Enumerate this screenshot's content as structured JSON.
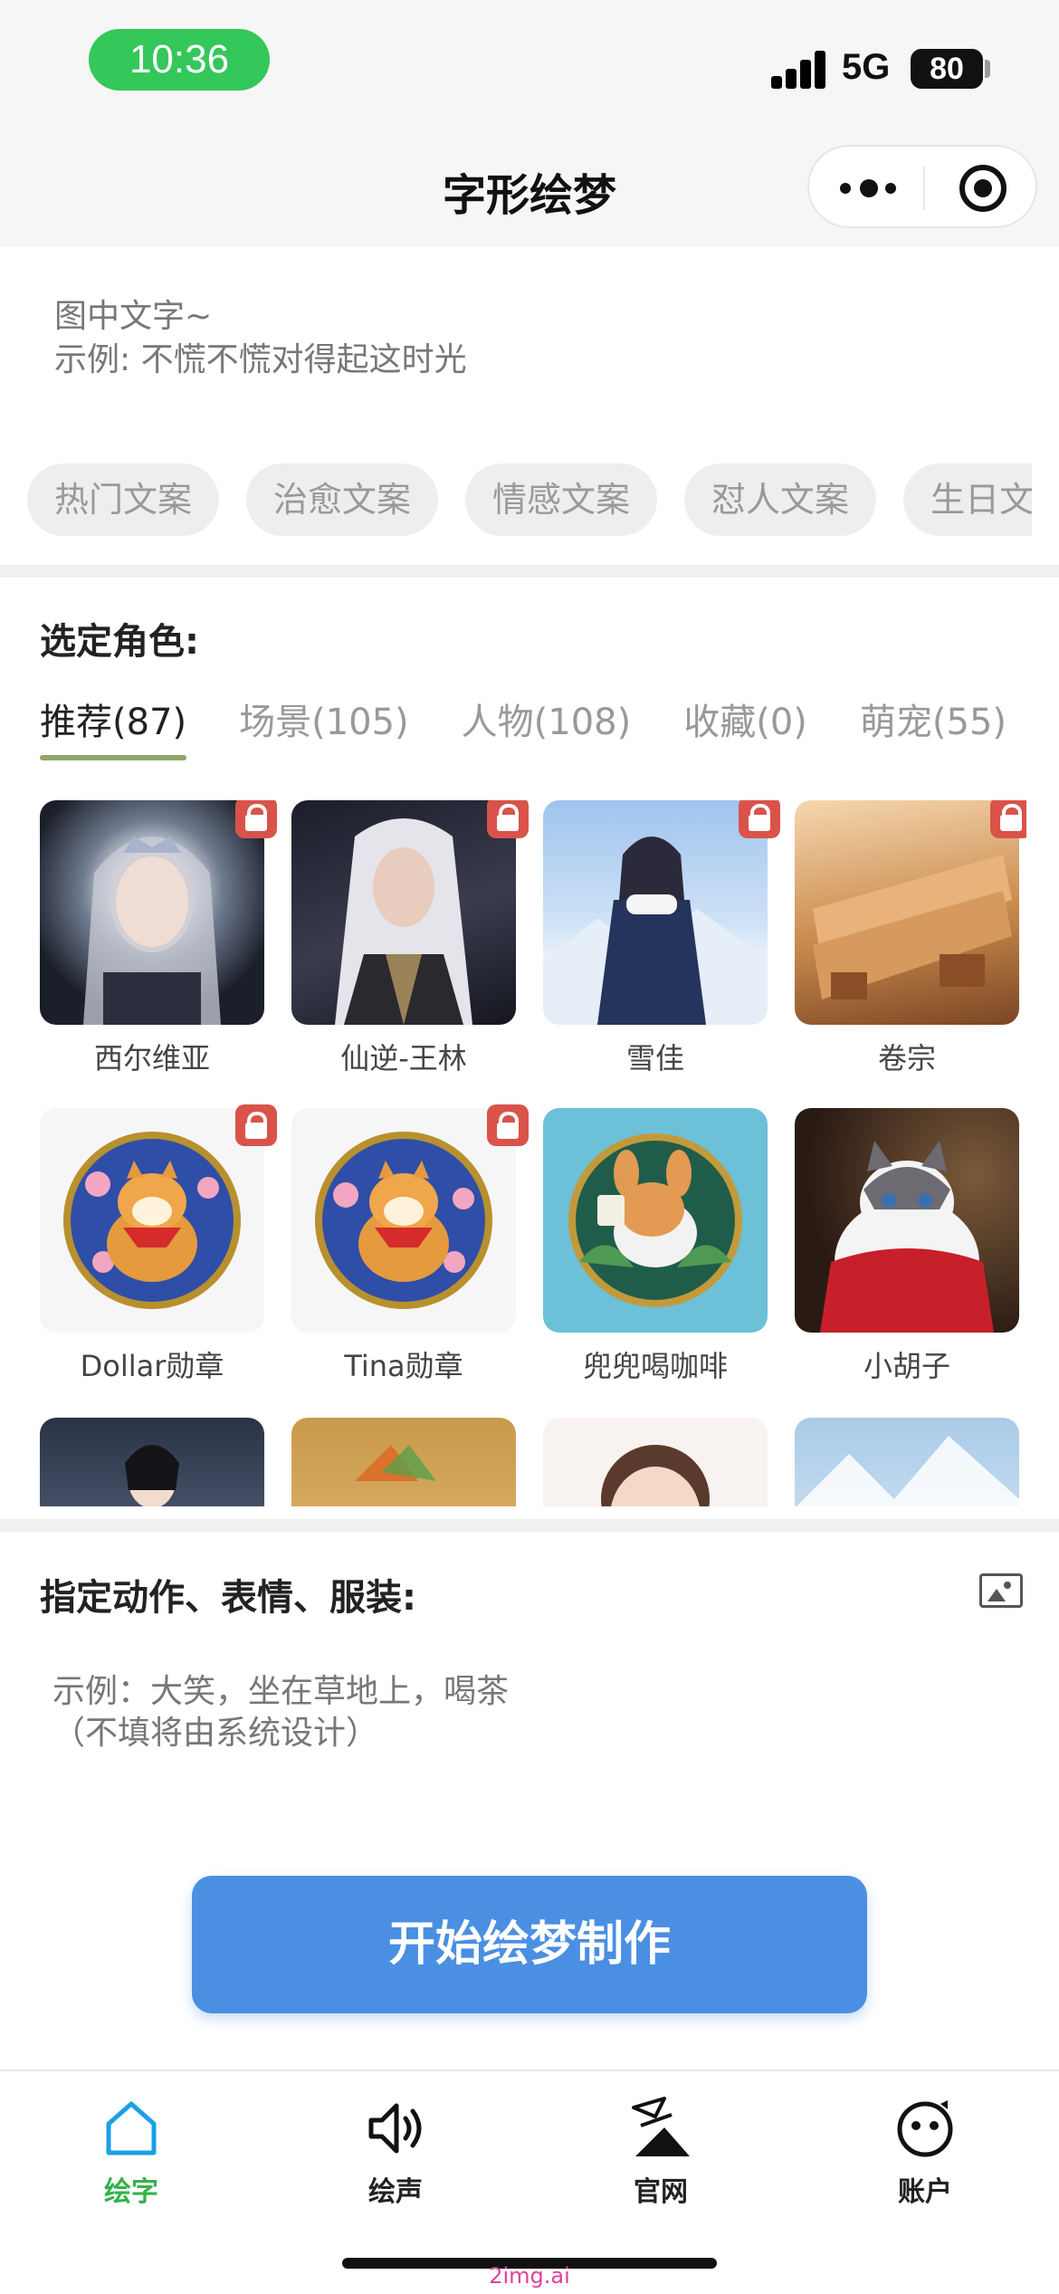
{
  "status_bar": {
    "time": "10:36",
    "network": "5G",
    "battery": "80"
  },
  "nav": {
    "title": "字形绘梦"
  },
  "text_input": {
    "line1": "图中文字~",
    "line2": "示例: 不慌不慌对得起这时光"
  },
  "copy_chips": [
    "热门文案",
    "治愈文案",
    "情感文案",
    "怼人文案",
    "生日文案"
  ],
  "role_section": {
    "title": "选定角色:",
    "tabs": [
      {
        "label": "推荐(87)",
        "active": true
      },
      {
        "label": "场景(105)",
        "active": false
      },
      {
        "label": "人物(108)",
        "active": false
      },
      {
        "label": "收藏(0)",
        "active": false
      },
      {
        "label": "萌宠(55)",
        "active": false
      }
    ],
    "items": [
      {
        "name": "西尔维亚",
        "locked": true
      },
      {
        "name": "仙逆-王林",
        "locked": true
      },
      {
        "name": "雪佳",
        "locked": true
      },
      {
        "name": "卷宗",
        "locked": true
      },
      {
        "name": "Dollar勋章",
        "locked": true
      },
      {
        "name": "Tina勋章",
        "locked": true
      },
      {
        "name": "兜兜喝咖啡",
        "locked": false
      },
      {
        "name": "小胡子",
        "locked": false
      }
    ]
  },
  "action_section": {
    "title": "指定动作、表情、服装:",
    "hint_line1": "示例：大笑，坐在草地上，喝茶",
    "hint_line2": "（不填将由系统设计）"
  },
  "start_button": {
    "label": "开始绘梦制作"
  },
  "tab_bar": [
    {
      "label": "绘字",
      "icon": "home-icon",
      "active": true
    },
    {
      "label": "绘声",
      "icon": "speaker-icon",
      "active": false
    },
    {
      "label": "官网",
      "icon": "logo-icon",
      "active": false
    },
    {
      "label": "账户",
      "icon": "face-icon",
      "active": false
    }
  ],
  "watermark": "2img.ai",
  "colors": {
    "accent_blue": "#4a8fe2",
    "active_green": "#35b24a",
    "lock_red": "#d9534a",
    "tab_underline": "#8fa868",
    "time_pill": "#34c75a"
  }
}
